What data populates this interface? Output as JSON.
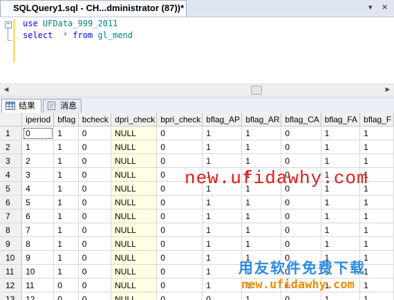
{
  "editor_tab": {
    "title": "SQLQuery1.sql - CH...dministrator (87))*"
  },
  "editor_controls": {
    "pin": "▾",
    "close": "✕"
  },
  "query": {
    "line1": {
      "keyword": "use",
      "name": "UFData_999_2011"
    },
    "line2": {
      "keyword": "select",
      "star": "*",
      "from": "from",
      "table": "gl_mend"
    }
  },
  "results_tabs": [
    {
      "label": "结果",
      "icon": "grid-icon",
      "active": true
    },
    {
      "label": "消息",
      "icon": "messages-icon",
      "active": false
    }
  ],
  "grid": {
    "columns": [
      "iperiod",
      "bflag",
      "bcheck",
      "dpri_check",
      "bpri_check",
      "bflag_AP",
      "bflag_AR",
      "bflag_CA",
      "bflag_FA",
      "bflag_F"
    ],
    "rows": [
      [
        "1",
        "0",
        "1",
        "0",
        "NULL",
        "0",
        "1",
        "1",
        "0",
        "1",
        "1"
      ],
      [
        "2",
        "1",
        "1",
        "0",
        "NULL",
        "0",
        "1",
        "1",
        "0",
        "1",
        "1"
      ],
      [
        "3",
        "2",
        "1",
        "0",
        "NULL",
        "0",
        "1",
        "1",
        "0",
        "1",
        "1"
      ],
      [
        "4",
        "3",
        "1",
        "0",
        "NULL",
        "0",
        "1",
        "1",
        "0",
        "1",
        "1"
      ],
      [
        "5",
        "4",
        "1",
        "0",
        "NULL",
        "0",
        "1",
        "1",
        "0",
        "1",
        "1"
      ],
      [
        "6",
        "5",
        "1",
        "0",
        "NULL",
        "0",
        "1",
        "1",
        "0",
        "1",
        "1"
      ],
      [
        "7",
        "6",
        "1",
        "0",
        "NULL",
        "0",
        "1",
        "1",
        "0",
        "1",
        "1"
      ],
      [
        "8",
        "7",
        "1",
        "0",
        "NULL",
        "0",
        "1",
        "1",
        "0",
        "1",
        "1"
      ],
      [
        "9",
        "8",
        "1",
        "0",
        "NULL",
        "0",
        "1",
        "1",
        "0",
        "1",
        "1"
      ],
      [
        "10",
        "9",
        "1",
        "0",
        "NULL",
        "0",
        "1",
        "1",
        "0",
        "1",
        "1"
      ],
      [
        "11",
        "10",
        "1",
        "0",
        "NULL",
        "0",
        "1",
        "1",
        "0",
        "1",
        "1"
      ],
      [
        "12",
        "11",
        "0",
        "0",
        "NULL",
        "0",
        "1",
        "1",
        "0",
        "1",
        "1"
      ],
      [
        "13",
        "12",
        "0",
        "0",
        "NULL",
        "0",
        "0",
        "1",
        "0",
        "1",
        "1"
      ]
    ]
  },
  "watermark": {
    "url": "new.ufidawhy.com",
    "logo_cn": "用友软件免费下载",
    "logo_url": "new.ufidawhy.com"
  },
  "colors": {
    "keyword": "#0000ff",
    "identifier": "#008080",
    "null_cell": "#ffffe1",
    "watermark_red": "#e31919",
    "watermark_blue": "#2a8ae0",
    "watermark_orange": "#f08c00"
  }
}
